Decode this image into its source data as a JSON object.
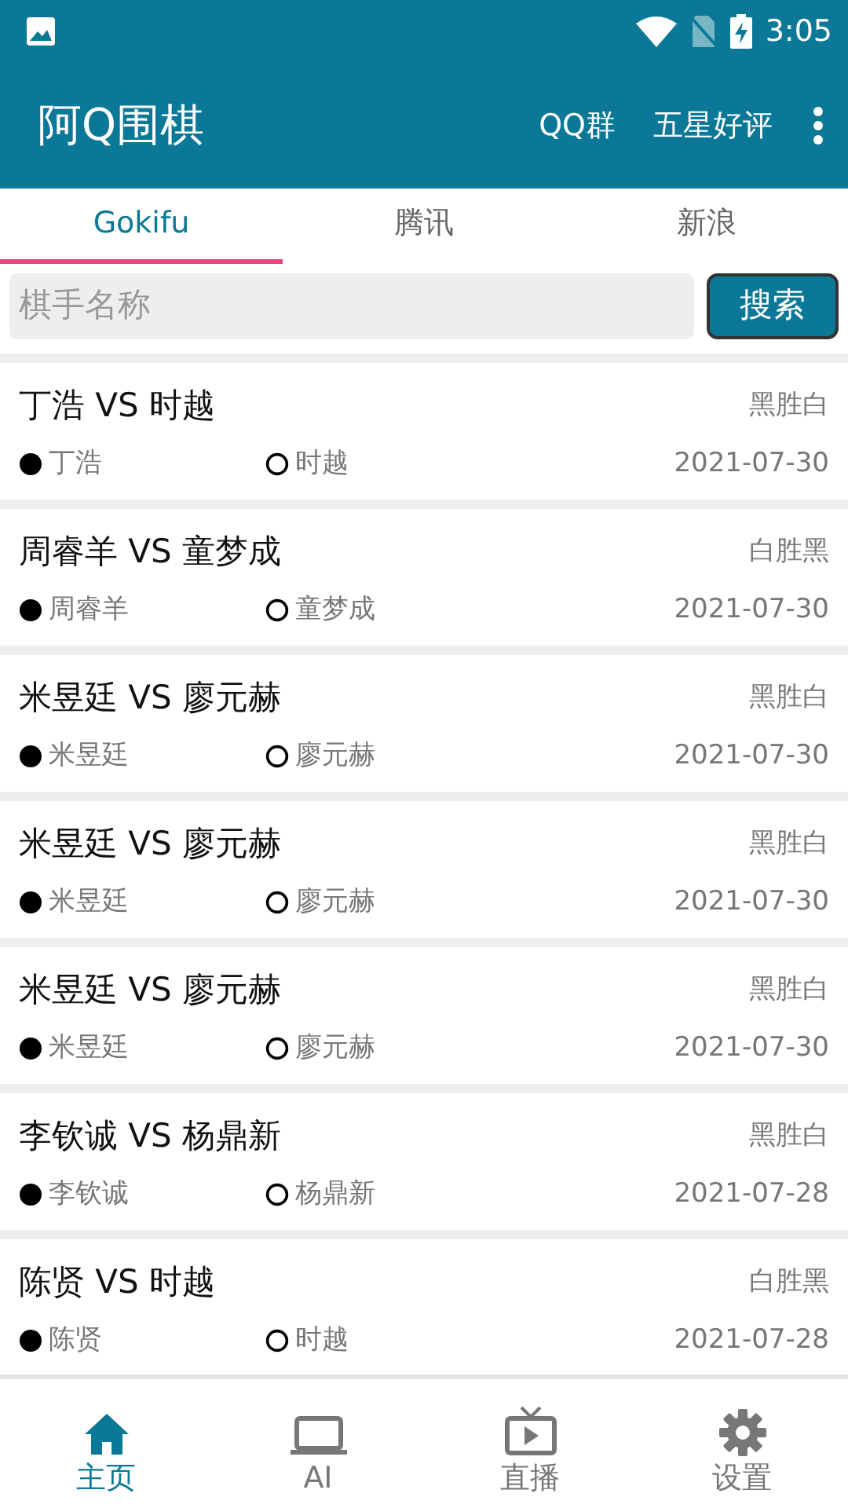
{
  "status_bar": {
    "time": "3:05"
  },
  "app_bar": {
    "title": "阿Q围棋",
    "actions": [
      "QQ群",
      "五星好评"
    ]
  },
  "tabs": [
    {
      "label": "Gokifu",
      "selected": true
    },
    {
      "label": "腾讯",
      "selected": false
    },
    {
      "label": "新浪",
      "selected": false
    }
  ],
  "search": {
    "placeholder": "棋手名称",
    "button": "搜索"
  },
  "games": [
    {
      "title": "丁浩 VS 时越",
      "result": "黑胜白",
      "black": "丁浩",
      "white": "时越",
      "date": "2021-07-30"
    },
    {
      "title": "周睿羊 VS 童梦成",
      "result": "白胜黑",
      "black": "周睿羊",
      "white": "童梦成",
      "date": "2021-07-30"
    },
    {
      "title": "米昱廷 VS 廖元赫",
      "result": "黑胜白",
      "black": "米昱廷",
      "white": "廖元赫",
      "date": "2021-07-30"
    },
    {
      "title": "米昱廷 VS 廖元赫",
      "result": "黑胜白",
      "black": "米昱廷",
      "white": "廖元赫",
      "date": "2021-07-30"
    },
    {
      "title": "米昱廷 VS 廖元赫",
      "result": "黑胜白",
      "black": "米昱廷",
      "white": "廖元赫",
      "date": "2021-07-30"
    },
    {
      "title": "李钦诚 VS 杨鼎新",
      "result": "黑胜白",
      "black": "李钦诚",
      "white": "杨鼎新",
      "date": "2021-07-28"
    },
    {
      "title": "陈贤 VS 时越",
      "result": "白胜黑",
      "black": "陈贤",
      "white": "时越",
      "date": "2021-07-28"
    }
  ],
  "bottom_nav": [
    {
      "label": "主页",
      "selected": true
    },
    {
      "label": "AI",
      "selected": false
    },
    {
      "label": "直播",
      "selected": false
    },
    {
      "label": "设置",
      "selected": false
    }
  ]
}
